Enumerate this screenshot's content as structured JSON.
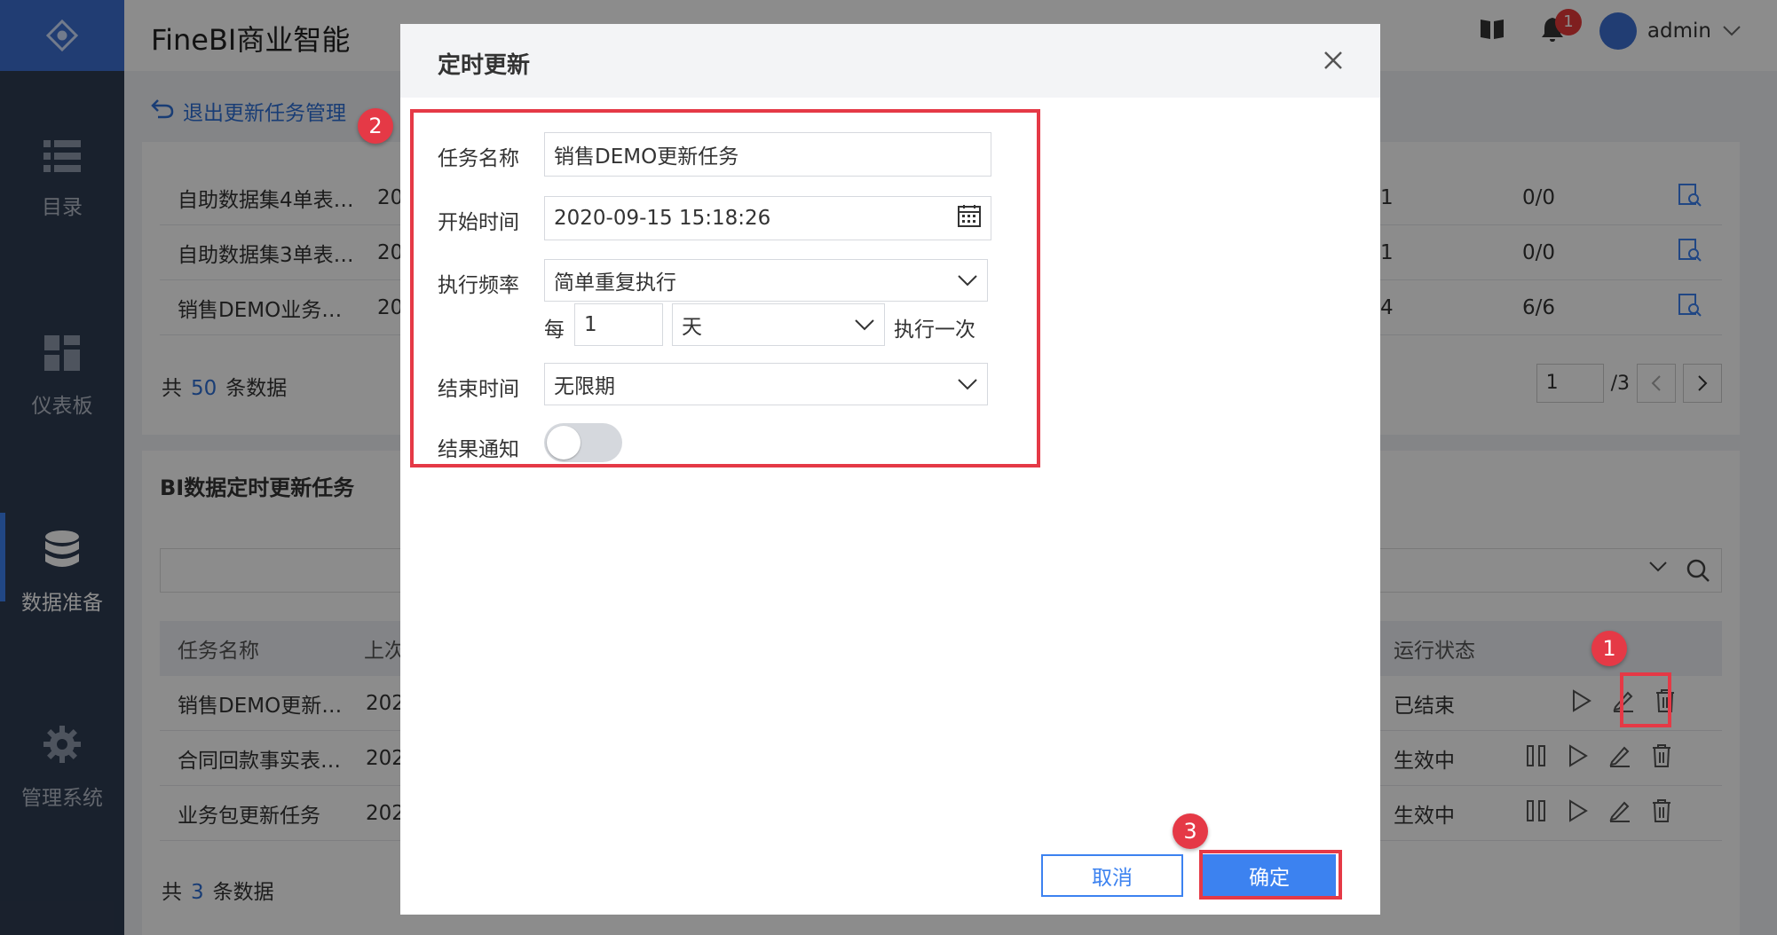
{
  "app": {
    "title": "FineBI商业智能",
    "user": "admin",
    "notification_count": "1"
  },
  "sidebar": {
    "items": [
      {
        "label": "目录",
        "icon": "list-icon"
      },
      {
        "label": "仪表板",
        "icon": "dashboard-icon"
      },
      {
        "label": "数据准备",
        "icon": "database-icon"
      },
      {
        "label": "管理系统",
        "icon": "gear-icon"
      }
    ]
  },
  "main": {
    "exit_link": "退出更新任务管理",
    "top_table": {
      "rows": [
        {
          "name": "自助数据集4单表…",
          "date": "20",
          "col3": "1",
          "progress": "0/0"
        },
        {
          "name": "自助数据集3单表…",
          "date": "20",
          "col3": "1",
          "progress": "0/0"
        },
        {
          "name": "销售DEMO业务…",
          "date": "20",
          "col3": "4",
          "progress": "6/6"
        }
      ],
      "footer_prefix": "共",
      "footer_count": "50",
      "footer_suffix": "条数据",
      "page": "1",
      "page_total": "/3"
    },
    "bottom_table": {
      "title": "BI数据定时更新任务",
      "headers": {
        "name": "任务名称",
        "last": "上次",
        "status": "运行状态"
      },
      "rows": [
        {
          "name": "销售DEMO更新…",
          "date": "202",
          "status": "已结束"
        },
        {
          "name": "合同回款事实表…",
          "date": "202",
          "status": "生效中"
        },
        {
          "name": "业务包更新任务",
          "date": "202",
          "status": "生效中"
        }
      ],
      "footer_prefix": "共",
      "footer_count": "3",
      "footer_suffix": "条数据"
    }
  },
  "dialog": {
    "title": "定时更新",
    "task_name_label": "任务名称",
    "task_name_value": "销售DEMO更新任务",
    "start_label": "开始时间",
    "start_value": "2020-09-15 15:18:26",
    "freq_label": "执行频率",
    "freq_value": "简单重复执行",
    "every_label": "每",
    "every_value": "1",
    "unit_value": "天",
    "once_label": "执行一次",
    "end_label": "结束时间",
    "end_value": "无限期",
    "notify_label": "结果通知",
    "notify_on": false,
    "cancel": "取消",
    "ok": "确定"
  },
  "steps": [
    "1",
    "2",
    "3"
  ],
  "colors": {
    "accent": "#3c82f0",
    "highlight": "#e53946",
    "sidebar": "#2f3c52"
  }
}
